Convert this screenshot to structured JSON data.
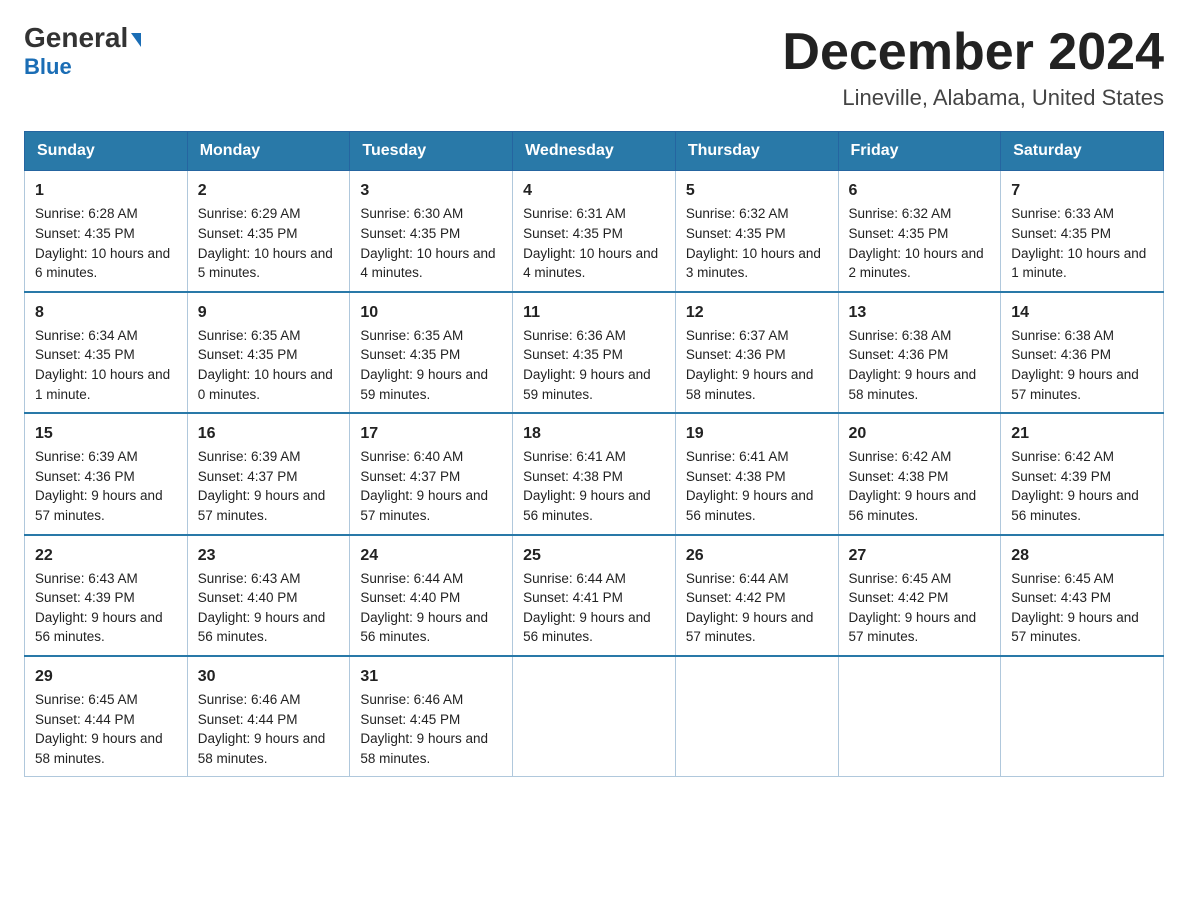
{
  "logo": {
    "line1a": "General",
    "line1b": "Blue",
    "line2": "Blue"
  },
  "title": "December 2024",
  "subtitle": "Lineville, Alabama, United States",
  "days": [
    "Sunday",
    "Monday",
    "Tuesday",
    "Wednesday",
    "Thursday",
    "Friday",
    "Saturday"
  ],
  "weeks": [
    [
      {
        "day": "1",
        "sunrise": "6:28 AM",
        "sunset": "4:35 PM",
        "daylight": "10 hours and 6 minutes."
      },
      {
        "day": "2",
        "sunrise": "6:29 AM",
        "sunset": "4:35 PM",
        "daylight": "10 hours and 5 minutes."
      },
      {
        "day": "3",
        "sunrise": "6:30 AM",
        "sunset": "4:35 PM",
        "daylight": "10 hours and 4 minutes."
      },
      {
        "day": "4",
        "sunrise": "6:31 AM",
        "sunset": "4:35 PM",
        "daylight": "10 hours and 4 minutes."
      },
      {
        "day": "5",
        "sunrise": "6:32 AM",
        "sunset": "4:35 PM",
        "daylight": "10 hours and 3 minutes."
      },
      {
        "day": "6",
        "sunrise": "6:32 AM",
        "sunset": "4:35 PM",
        "daylight": "10 hours and 2 minutes."
      },
      {
        "day": "7",
        "sunrise": "6:33 AM",
        "sunset": "4:35 PM",
        "daylight": "10 hours and 1 minute."
      }
    ],
    [
      {
        "day": "8",
        "sunrise": "6:34 AM",
        "sunset": "4:35 PM",
        "daylight": "10 hours and 1 minute."
      },
      {
        "day": "9",
        "sunrise": "6:35 AM",
        "sunset": "4:35 PM",
        "daylight": "10 hours and 0 minutes."
      },
      {
        "day": "10",
        "sunrise": "6:35 AM",
        "sunset": "4:35 PM",
        "daylight": "9 hours and 59 minutes."
      },
      {
        "day": "11",
        "sunrise": "6:36 AM",
        "sunset": "4:35 PM",
        "daylight": "9 hours and 59 minutes."
      },
      {
        "day": "12",
        "sunrise": "6:37 AM",
        "sunset": "4:36 PM",
        "daylight": "9 hours and 58 minutes."
      },
      {
        "day": "13",
        "sunrise": "6:38 AM",
        "sunset": "4:36 PM",
        "daylight": "9 hours and 58 minutes."
      },
      {
        "day": "14",
        "sunrise": "6:38 AM",
        "sunset": "4:36 PM",
        "daylight": "9 hours and 57 minutes."
      }
    ],
    [
      {
        "day": "15",
        "sunrise": "6:39 AM",
        "sunset": "4:36 PM",
        "daylight": "9 hours and 57 minutes."
      },
      {
        "day": "16",
        "sunrise": "6:39 AM",
        "sunset": "4:37 PM",
        "daylight": "9 hours and 57 minutes."
      },
      {
        "day": "17",
        "sunrise": "6:40 AM",
        "sunset": "4:37 PM",
        "daylight": "9 hours and 57 minutes."
      },
      {
        "day": "18",
        "sunrise": "6:41 AM",
        "sunset": "4:38 PM",
        "daylight": "9 hours and 56 minutes."
      },
      {
        "day": "19",
        "sunrise": "6:41 AM",
        "sunset": "4:38 PM",
        "daylight": "9 hours and 56 minutes."
      },
      {
        "day": "20",
        "sunrise": "6:42 AM",
        "sunset": "4:38 PM",
        "daylight": "9 hours and 56 minutes."
      },
      {
        "day": "21",
        "sunrise": "6:42 AM",
        "sunset": "4:39 PM",
        "daylight": "9 hours and 56 minutes."
      }
    ],
    [
      {
        "day": "22",
        "sunrise": "6:43 AM",
        "sunset": "4:39 PM",
        "daylight": "9 hours and 56 minutes."
      },
      {
        "day": "23",
        "sunrise": "6:43 AM",
        "sunset": "4:40 PM",
        "daylight": "9 hours and 56 minutes."
      },
      {
        "day": "24",
        "sunrise": "6:44 AM",
        "sunset": "4:40 PM",
        "daylight": "9 hours and 56 minutes."
      },
      {
        "day": "25",
        "sunrise": "6:44 AM",
        "sunset": "4:41 PM",
        "daylight": "9 hours and 56 minutes."
      },
      {
        "day": "26",
        "sunrise": "6:44 AM",
        "sunset": "4:42 PM",
        "daylight": "9 hours and 57 minutes."
      },
      {
        "day": "27",
        "sunrise": "6:45 AM",
        "sunset": "4:42 PM",
        "daylight": "9 hours and 57 minutes."
      },
      {
        "day": "28",
        "sunrise": "6:45 AM",
        "sunset": "4:43 PM",
        "daylight": "9 hours and 57 minutes."
      }
    ],
    [
      {
        "day": "29",
        "sunrise": "6:45 AM",
        "sunset": "4:44 PM",
        "daylight": "9 hours and 58 minutes."
      },
      {
        "day": "30",
        "sunrise": "6:46 AM",
        "sunset": "4:44 PM",
        "daylight": "9 hours and 58 minutes."
      },
      {
        "day": "31",
        "sunrise": "6:46 AM",
        "sunset": "4:45 PM",
        "daylight": "9 hours and 58 minutes."
      },
      null,
      null,
      null,
      null
    ]
  ],
  "labels": {
    "sunrise": "Sunrise:",
    "sunset": "Sunset:",
    "daylight": "Daylight:"
  }
}
